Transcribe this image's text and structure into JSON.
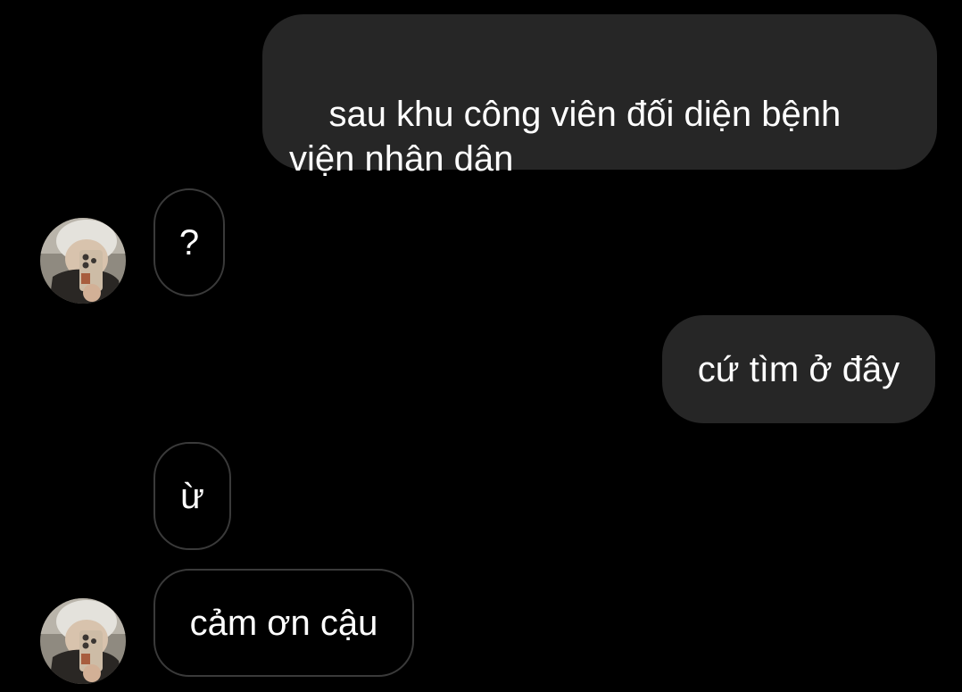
{
  "conversation": {
    "messages": [
      {
        "sender": "me",
        "text": "sau khu công viên đối diện bệnh viện nhân dân"
      },
      {
        "sender": "contact",
        "text": "?"
      },
      {
        "sender": "me",
        "text": "cứ tìm ở đây"
      },
      {
        "sender": "contact",
        "text": "ừ"
      },
      {
        "sender": "contact",
        "text": "cảm ơn cậu"
      }
    ]
  },
  "colors": {
    "background": "#000000",
    "outgoing_bubble": "#262626",
    "incoming_border": "#3a3a3a",
    "text": "#ffffff"
  },
  "icons": {
    "avatar": "contact-avatar-photo"
  }
}
